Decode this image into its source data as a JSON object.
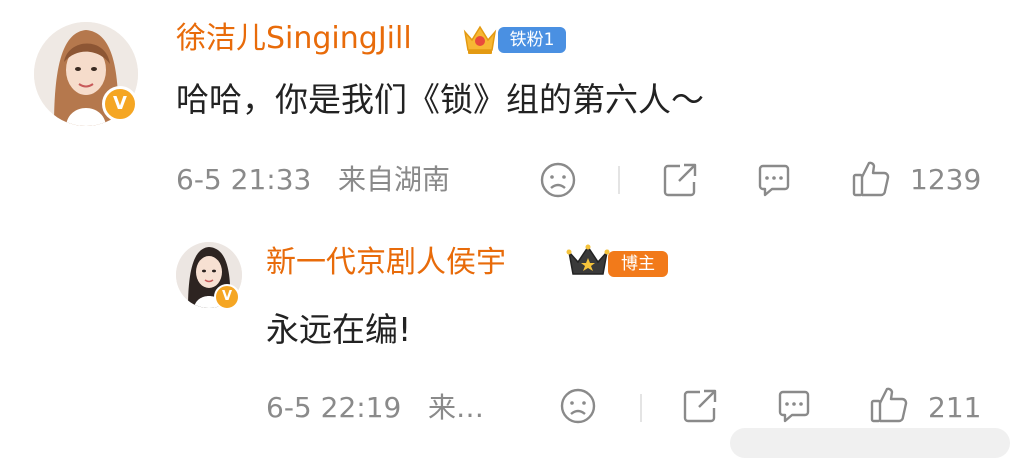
{
  "comment1": {
    "username": "徐洁儿SingingJill",
    "fan_badge": "铁粉1",
    "text": "哈哈，你是我们《锁》组的第六人～",
    "time": "6-5 21:33",
    "location": "来自湖南",
    "likes": "1239"
  },
  "comment2": {
    "username": "新一代京剧人侯宇",
    "role_badge": "博主",
    "text": "永远在编!",
    "time": "6-5 22:19",
    "location": "来…",
    "likes": "211"
  },
  "verified_mark": "V",
  "icons": [
    "dislike-icon",
    "share-icon",
    "comment-icon",
    "like-icon",
    "crown-icon"
  ],
  "colors": {
    "username": "#e86b0a",
    "badge_blue": "#4a90e2",
    "badge_orange": "#f27a1a",
    "verified": "#f5a623"
  }
}
